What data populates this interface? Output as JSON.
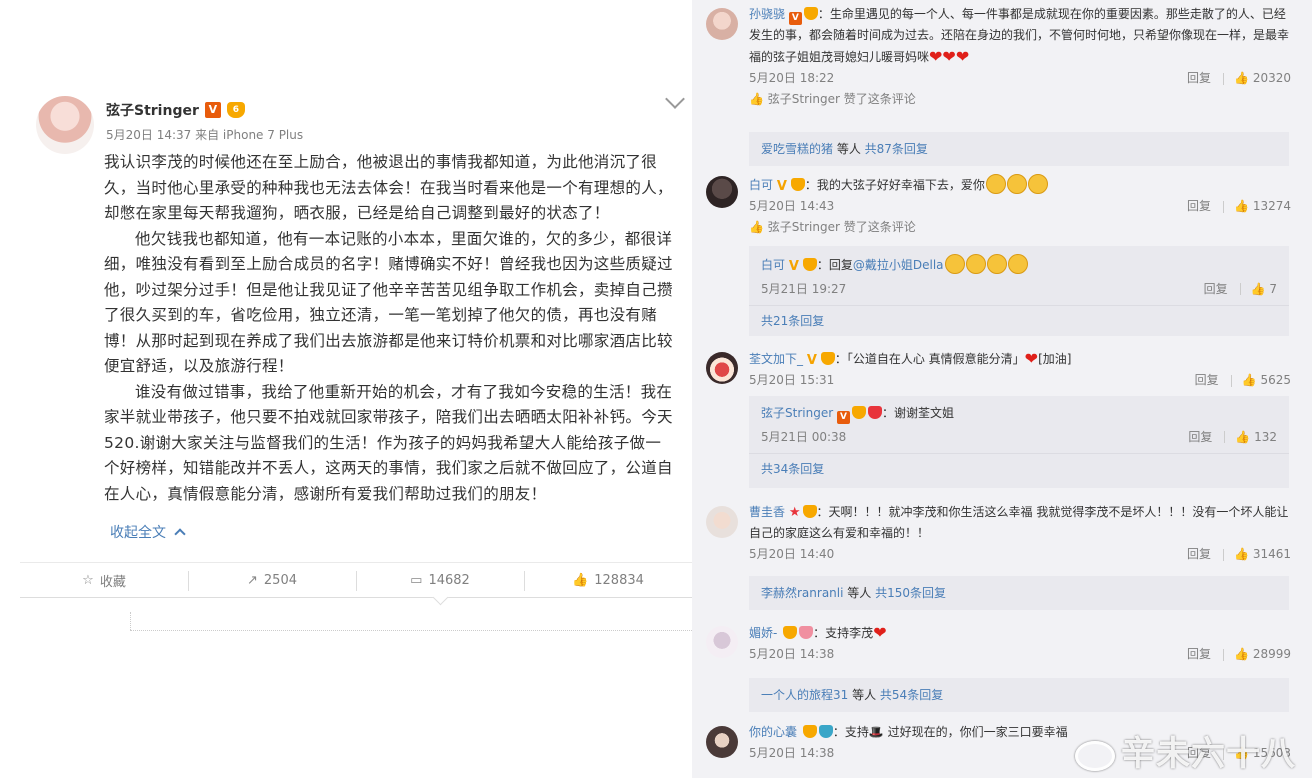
{
  "post": {
    "author": "弦子Stringer",
    "meta": "5月20日 14:37 来自 iPhone 7 Plus",
    "paragraphs": [
      "我认识李茂的时候他还在至上励合，他被退出的事情我都知道，为此他消沉了很久，当时他心里承受的种种我也无法去体会！在我当时看来他是一个有理想的人，却憋在家里每天帮我遛狗，晒衣服，已经是给自己调整到最好的状态了！",
      "他欠钱我也都知道，他有一本记账的小本本，里面欠谁的，欠的多少，都很详细，唯独没有看到至上励合成员的名字！赌博确实不好！曾经我也因为这些质疑过他，吵过架分过手！但是他让我见证了他辛辛苦苦见组争取工作机会，卖掉自己攒了很久买到的车，省吃俭用，独立还清，一笔一笔划掉了他欠的债，再也没有赌博！从那时起到现在养成了我们出去旅游都是他来订特价机票和对比哪家酒店比较便宜舒适，以及旅游行程！",
      "谁没有做过错事，我给了他重新开始的机会，才有了我如今安稳的生活！我在家半就业带孩子，他只要不拍戏就回家带孩子，陪我们出去晒晒太阳补补钙。今天520.谢谢大家关注与监督我们的生活！作为孩子的妈妈我希望大人能给孩子做一个好榜样，知错能改并不丢人，这两天的事情，我们家之后就不做回应了，公道自在人心，真情假意能分清，感谢所有爱我们帮助过我们的朋友！"
    ],
    "collapse_label": "收起全文",
    "actions": {
      "favorite": "收藏",
      "repost": "2504",
      "comment": "14682",
      "like": "128834"
    }
  },
  "comments": [
    {
      "name": "孙骁骁",
      "text": "：生命里遇见的每一个人、每一件事都是成就现在你的重要因素。那些走散了的人、已经发生的事，都会随着时间成为过去。还陪在身边的我们，不管何时何地，只希望你像现在一样，是最幸福的弦子姐姐茂哥媳妇儿暖哥妈咪",
      "time": "5月20日 18:22",
      "reply": "回复",
      "likes": "20320",
      "liked_by": "弦子Stringer 赞了这条评论",
      "sub_summary_user": "爱吃雪糕的猪",
      "sub_summary_mid": " 等人 ",
      "sub_summary_count": "共87条回复"
    },
    {
      "name": "白可",
      "text": "：我的大弦子好好幸福下去，爱你",
      "time": "5月20日 14:43",
      "reply": "回复",
      "likes": "13274",
      "liked_by": "弦子Stringer 赞了这条评论",
      "sub_name": "白可",
      "sub_text": "：回复",
      "sub_mention": "@戴拉小姐Della",
      "sub_time": "5月21日 19:27",
      "sub_reply": "回复",
      "sub_likes": "7",
      "sub_more": "共21条回复"
    },
    {
      "name": "荃文加下_",
      "text": "：「公道自在人心 真情假意能分清」",
      "text_tail": "[加油]",
      "time": "5月20日 15:31",
      "reply": "回复",
      "likes": "5625",
      "sub_name": "弦子Stringer",
      "sub_text": "：谢谢荃文姐",
      "sub_time": "5月21日 00:38",
      "sub_reply": "回复",
      "sub_likes": "132",
      "sub_more": "共34条回复"
    },
    {
      "name": "曹圭香",
      "text": "：天啊！！！就冲李茂和你生活这么幸福 我就觉得李茂不是坏人！！！没有一个坏人能让自己的家庭这么有爱和幸福的！！",
      "time": "5月20日 14:40",
      "reply": "回复",
      "likes": "31461",
      "sub_summary_user": "李赫然ranranli",
      "sub_summary_mid": " 等人 ",
      "sub_summary_count": "共150条回复"
    },
    {
      "name": "媚娇-",
      "text": "：支持李茂",
      "time": "5月20日 14:38",
      "reply": "回复",
      "likes": "28999",
      "sub_summary_user": "一个人的旅程31",
      "sub_summary_mid": " 等人 ",
      "sub_summary_count": "共54条回复"
    },
    {
      "name": "你的心囊",
      "text": "：支持",
      "text_tail": " 过好现在的，你们一家三口要幸福",
      "time": "5月20日 14:38",
      "reply": "回复",
      "likes": "15603"
    }
  ],
  "watermark": "辛未六十八",
  "colors": {
    "link": "#4a7eb7",
    "panel": "#f2f2f5",
    "subpanel": "#e9e9ee",
    "badge_v": "#e85c0c",
    "level": "#f7a800"
  }
}
